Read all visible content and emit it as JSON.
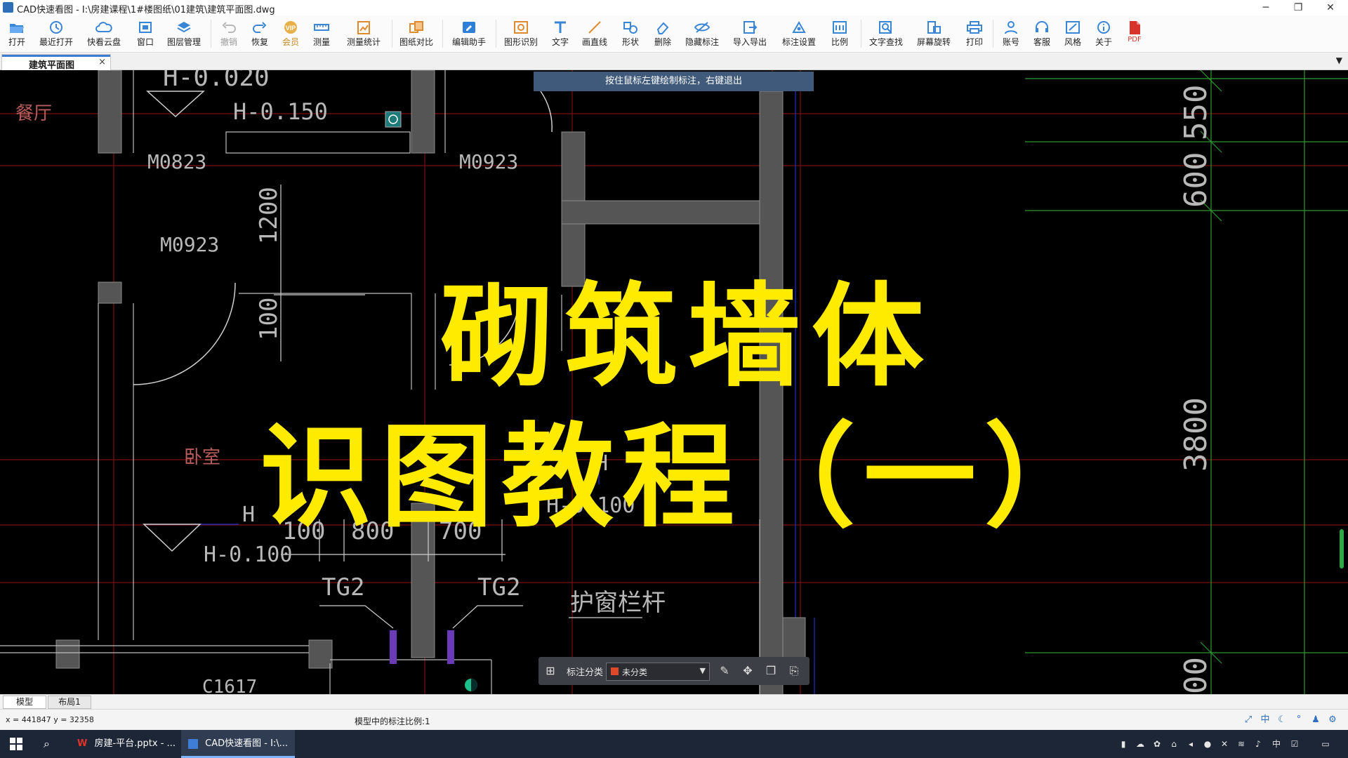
{
  "window": {
    "title": "CAD快速看图 - I:\\房建课程\\1#楼图纸\\01建筑\\建筑平面图.dwg",
    "minimize_glyph": "─",
    "restore_glyph": "❐",
    "close_glyph": "✕"
  },
  "toolbar": {
    "items": [
      {
        "label": "打开",
        "icon": "folder-open-icon"
      },
      {
        "label": "最近打开",
        "icon": "history-icon"
      },
      {
        "label": "快看云盘",
        "icon": "cloud-icon"
      },
      {
        "label": "窗口",
        "icon": "window-icon"
      },
      {
        "label": "图层管理",
        "icon": "layers-icon"
      },
      {
        "label": "撤销",
        "icon": "undo-icon",
        "disabled": true
      },
      {
        "label": "恢复",
        "icon": "redo-icon"
      },
      {
        "label": "会员",
        "icon": "vip-icon"
      },
      {
        "label": "测量",
        "icon": "ruler-icon"
      },
      {
        "label": "测量统计",
        "icon": "measure-stats-icon"
      },
      {
        "label": "图纸对比",
        "icon": "compare-icon"
      },
      {
        "label": "编辑助手",
        "icon": "edit-assistant-icon"
      },
      {
        "label": "图形识别",
        "icon": "shape-recognition-icon"
      },
      {
        "label": "文字",
        "icon": "text-icon"
      },
      {
        "label": "画直线",
        "icon": "line-icon"
      },
      {
        "label": "形状",
        "icon": "shape-icon"
      },
      {
        "label": "删除",
        "icon": "eraser-icon"
      },
      {
        "label": "隐藏标注",
        "icon": "hide-annotation-icon"
      },
      {
        "label": "导入导出",
        "icon": "import-export-icon"
      },
      {
        "label": "标注设置",
        "icon": "annotation-settings-icon"
      },
      {
        "label": "比例",
        "icon": "scale-icon"
      },
      {
        "label": "文字查找",
        "icon": "text-search-icon"
      },
      {
        "label": "屏幕旋转",
        "icon": "rotate-screen-icon"
      },
      {
        "label": "打印",
        "icon": "printer-icon"
      },
      {
        "label": "账号",
        "icon": "user-icon"
      },
      {
        "label": "客服",
        "icon": "headset-icon"
      },
      {
        "label": "风格",
        "icon": "style-icon"
      },
      {
        "label": "关于",
        "icon": "info-icon"
      },
      {
        "label": "PDF",
        "icon": "pdf-icon"
      }
    ]
  },
  "tabs": {
    "active": "建筑平面图",
    "close_glyph": "×",
    "dropdown_glyph": "▼"
  },
  "canvas": {
    "hint": "按住鼠标左键绘制标注，右键退出",
    "overlay_line1": "砌筑墙体",
    "overlay_line2": "识图教程（一）",
    "labels": {
      "room_dining": "餐厅",
      "room_bedroom": "卧室",
      "elev_top": "H-0.020",
      "elev_150": "H-0.150",
      "elev_100_left": "H-0.100",
      "elev_100_right": "H-0.100",
      "h_left": "H",
      "h_right": "H",
      "door_m0823": "M0823",
      "door_m0923_top": "M0923",
      "door_m0923_mid": "M0923",
      "door_partial": "M0923",
      "dim_1200": "1200",
      "dim_100_v": "100",
      "dim_100": "100",
      "dim_800": "800",
      "dim_700": "700",
      "tg2_left": "TG2",
      "tg2_right": "TG2",
      "window_rail": "护窗栏杆",
      "window_c1617": "C1617",
      "dim_550": "550",
      "dim_600": "600",
      "dim_3800": "3800",
      "dim_bottom": "00"
    }
  },
  "annotation_toolbar": {
    "label": "标注分类",
    "selected": "未分类",
    "swatch_color": "#e0482a"
  },
  "layout_tabs": [
    "模型",
    "布局1"
  ],
  "status": {
    "coords": "x = 441847  y = 32358",
    "scale_text": "模型中的标注比例:1"
  },
  "taskbar": {
    "apps": [
      {
        "label": "房建-平台.pptx - ...",
        "icon": "wps-icon"
      },
      {
        "label": "CAD快速看图 - I:\\...",
        "icon": "cad-icon",
        "active": true
      }
    ],
    "ime": "中"
  },
  "colors": {
    "overlay_text": "#ffeb00",
    "wall_fill": "#5a5a5a",
    "axis_red": "#8a1a1a",
    "dim_green": "#3fa33f",
    "hint_bg": "#3f5a7a"
  }
}
